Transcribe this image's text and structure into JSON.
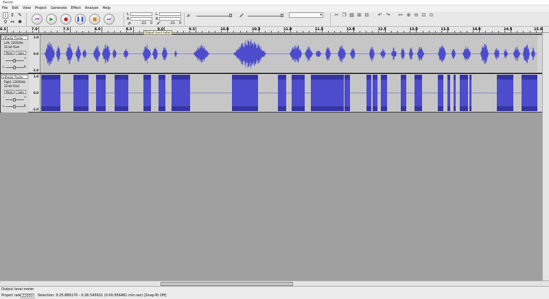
{
  "window": {
    "title": "Parrot"
  },
  "menu": [
    "File",
    "Edit",
    "View",
    "Project",
    "Generate",
    "Effect",
    "Analyze",
    "Help"
  ],
  "meters": {
    "scale_low": "-21",
    "scale_zero": "0",
    "tooltip": "Output level meter",
    "left_label": "L",
    "right_label": "R"
  },
  "ruler": {
    "labels": [
      "6.5",
      "7.0",
      "7.5",
      "8.0",
      "8.5",
      "9.0",
      "9.5",
      "10.0",
      "10.5",
      "11.0",
      "11.5",
      "12.0",
      "12.5",
      "13.0",
      "13.5",
      "14.0",
      "14.5",
      "15.0"
    ]
  },
  "tracks": [
    {
      "name": "Audio Track",
      "info_line1": "Left, 22050Hz",
      "info_line2": "32-bit float",
      "mute": "Mute",
      "solo": "Solo",
      "pan_l": "L",
      "pan_r": "R",
      "plus": "+",
      "minus": "-",
      "scale_top": "1.0",
      "scale_mid": "0.0",
      "scale_bottom": "-1.0"
    },
    {
      "name": "Audio Track",
      "info_line1": "Right, 22050Hz",
      "info_line2": "32-bit float",
      "mute": "Mute",
      "solo": "Solo",
      "pan_l": "L",
      "pan_r": "R",
      "plus": "+",
      "minus": "-",
      "scale_top": "1.0",
      "scale_mid": "0.0",
      "scale_bottom": "-1.0"
    }
  ],
  "status": {
    "message": "Output level meter",
    "project_rate_label": "Project rate:",
    "project_rate_value": "22050",
    "selection": "Selection: 0:25.889170 - 0:26.545631 (0:00.656461 min:sec)  [Snap-To Off]"
  },
  "colors": {
    "wave": "#4c4ccc",
    "wave_dark": "#3434a8",
    "track_bg": "#c6c6c6",
    "app_bg": "#a0a0a0"
  }
}
